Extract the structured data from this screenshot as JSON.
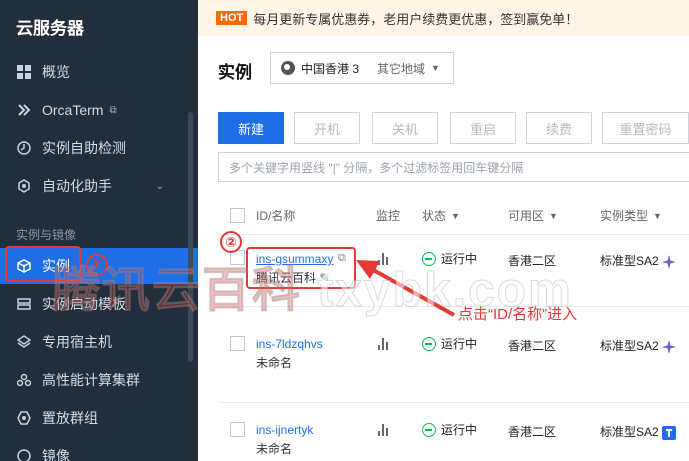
{
  "sidebar": {
    "title": "云服务器",
    "items": [
      {
        "label": "概览",
        "icon": "grid-icon"
      },
      {
        "label": "OrcaTerm",
        "icon": "terminal-icon"
      },
      {
        "label": "实例自助检测",
        "icon": "check-circle-icon"
      },
      {
        "label": "自动化助手",
        "icon": "robot-icon"
      },
      {
        "label": "实例",
        "icon": "cube-icon"
      },
      {
        "label": "实例启动模板",
        "icon": "template-icon"
      },
      {
        "label": "专用宿主机",
        "icon": "host-icon"
      },
      {
        "label": "高性能计算集群",
        "icon": "cluster-icon"
      },
      {
        "label": "置放群组",
        "icon": "placement-icon"
      },
      {
        "label": "镜像",
        "icon": "image-icon"
      }
    ],
    "section_label": "实例与镜像"
  },
  "notice": {
    "badge": "HOT",
    "text": "每月更新专属优惠券，老用户续费更优惠，签到赢免单！"
  },
  "header": {
    "title": "实例",
    "region": "中国香港 3",
    "other_regions": "其它地域"
  },
  "toolbar": {
    "buttons": [
      "新建",
      "开机",
      "关机",
      "重启",
      "续费",
      "重置密码"
    ],
    "search_placeholder": "多个关键字用竖线 \"|\" 分隔，多个过滤标签用回车键分隔"
  },
  "table": {
    "headers": {
      "id_name": "ID/名称",
      "monitor": "监控",
      "status": "状态",
      "zone": "可用区",
      "type": "实例类型"
    },
    "rows": [
      {
        "id": "ins-gsummaxy",
        "name": "腾讯云百科",
        "status": "运行中",
        "zone": "香港二区",
        "type": "标准型SA2"
      },
      {
        "id": "ins-7ldzqhvs",
        "name": "未命名",
        "status": "运行中",
        "zone": "香港二区",
        "type": "标准型SA2"
      },
      {
        "id": "ins-ijnertyk",
        "name": "未命名",
        "status": "运行中",
        "zone": "香港二区",
        "type": "标准型SA2"
      }
    ]
  },
  "annotations": {
    "step1": "①",
    "step2": "②",
    "hint": "点击“ID/名称”进入",
    "watermark_cn": "腾讯云百科",
    "watermark_url": "txybk.com",
    "color": "#e53935"
  },
  "colors": {
    "accent": "#1e6ee6",
    "sidebar_bg": "#232e3c",
    "running": "#0abf5b",
    "hot": "#ff6a00"
  }
}
